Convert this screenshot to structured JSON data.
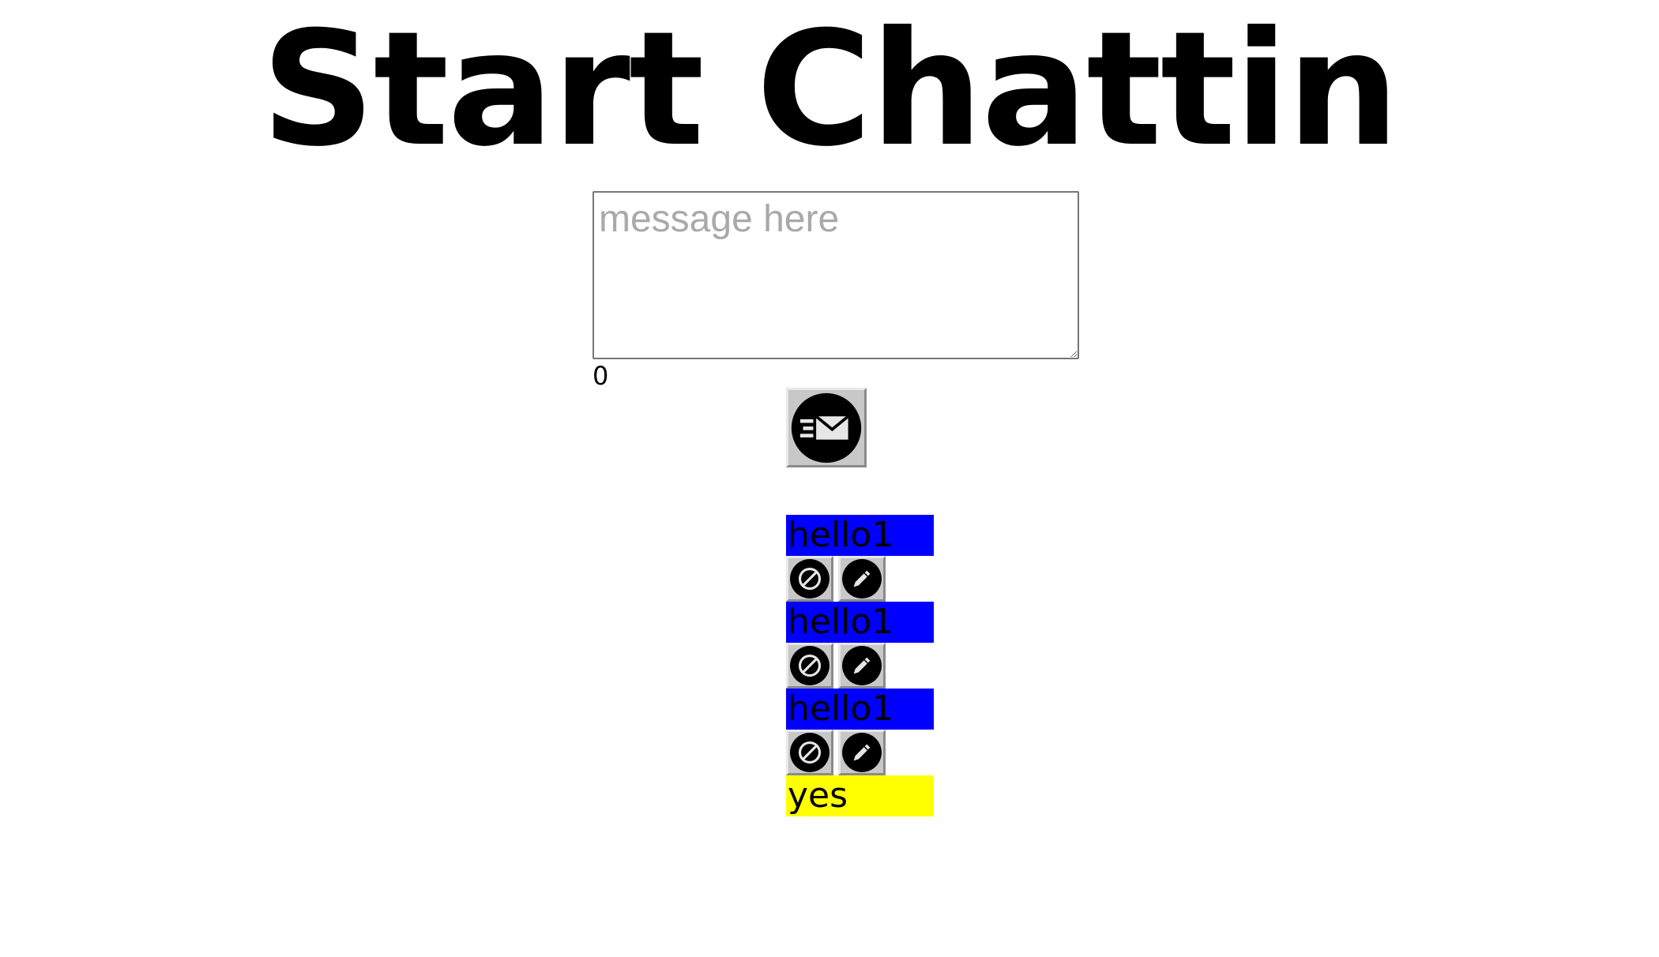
{
  "header": {
    "title": "Start Chattin"
  },
  "composer": {
    "placeholder": "message here",
    "value": "",
    "char_count": "0"
  },
  "send_button": {
    "icon": "send-mail-icon"
  },
  "messages": [
    {
      "text": "hello1",
      "kind": "sent",
      "color": "#0000ff",
      "actions": [
        "block-icon",
        "pencil-icon"
      ]
    },
    {
      "text": "hello1",
      "kind": "sent",
      "color": "#0000ff",
      "actions": [
        "block-icon",
        "pencil-icon"
      ]
    },
    {
      "text": "hello1",
      "kind": "sent",
      "color": "#0000ff",
      "actions": [
        "block-icon",
        "pencil-icon"
      ]
    },
    {
      "text": "yes",
      "kind": "received",
      "color": "#ffff00",
      "actions": []
    }
  ]
}
